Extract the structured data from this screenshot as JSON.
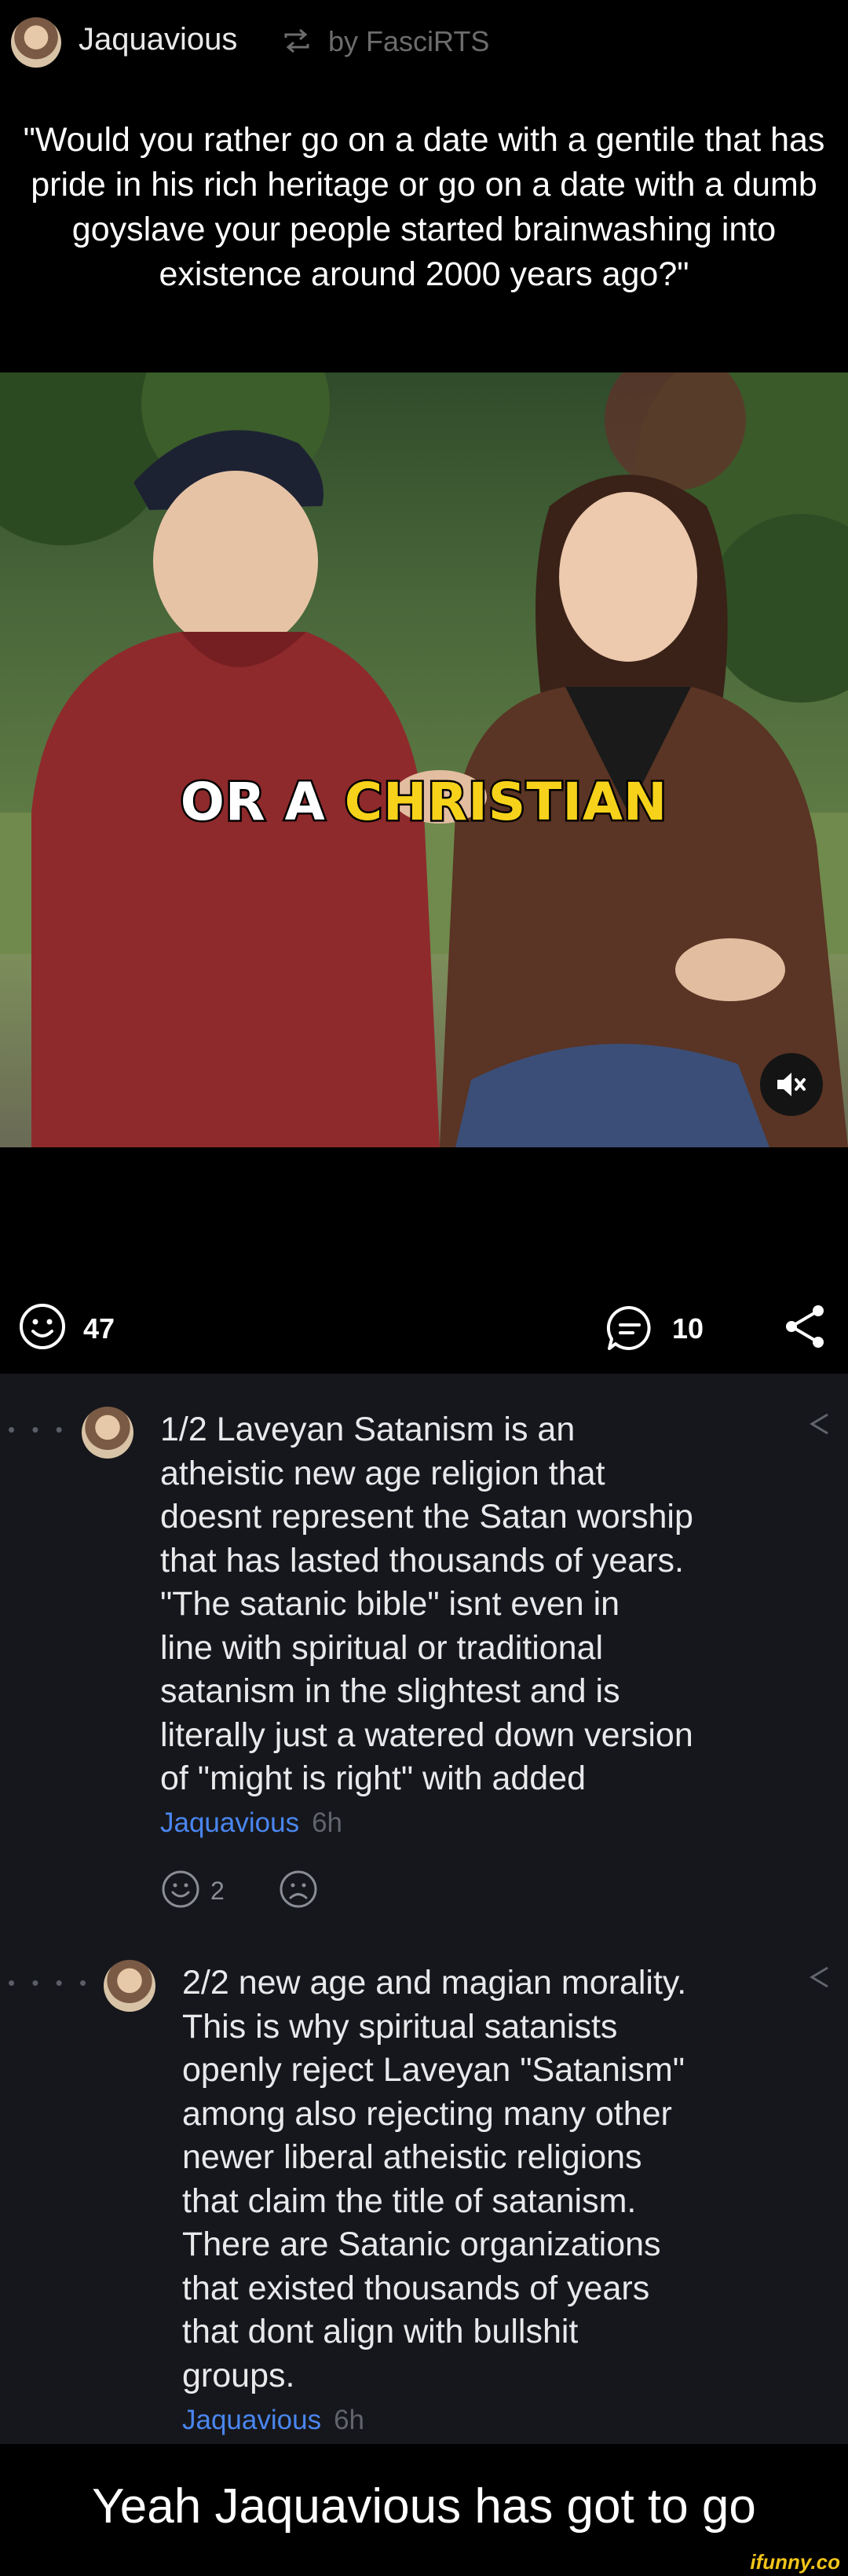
{
  "header": {
    "author": "Jaquavious",
    "repost_icon": "repost-icon",
    "by_text": "by FasciRTS"
  },
  "caption": "\"Would you rather go on a date with a gentile that has pride in his rich heritage or go on a date with a dumb goyslave your people started brainwashing into existence around 2000 years ago?\"",
  "video": {
    "caption_word1": "OR A",
    "caption_word2": "CHRISTIAN",
    "mute_icon": "muted-speaker-icon"
  },
  "actions": {
    "smile_count": "47",
    "comment_count": "10",
    "icons": [
      "smile-icon",
      "comment-icon",
      "share-icon"
    ]
  },
  "comments": [
    {
      "text_lines": [
        "1/2 Laveyan Satanism is an",
        "atheistic new age religion that",
        "doesnt represent the Satan worship",
        "that has lasted thousands of years.",
        "\"The satanic bible\" isnt even in",
        "line with spiritual or traditional",
        "satanism in the slightest and is",
        "literally just a watered down version",
        "of \"might is right\" with added"
      ],
      "author": "Jaquavious",
      "time": "6h",
      "smile_count": "2"
    },
    {
      "text_lines": [
        "2/2 new age and magian morality.",
        "This is why spiritual satanists",
        "openly reject Laveyan \"Satanism\"",
        "among also rejecting many other",
        "newer liberal atheistic religions",
        "that claim the title of satanism.",
        "There are Satanic organizations",
        "that existed thousands of years",
        "that dont align with bullshit",
        "groups."
      ],
      "author": "Jaquavious",
      "time": "6h"
    }
  ],
  "bottom_caption": "Yeah Jaquavious has got to go",
  "watermark": "ifunny.co",
  "colors": {
    "background": "#000000",
    "comments_bg": "#16171c",
    "author_link": "#4a86f0",
    "caption_highlight": "#f7d21a",
    "watermark": "#f2c41a"
  }
}
